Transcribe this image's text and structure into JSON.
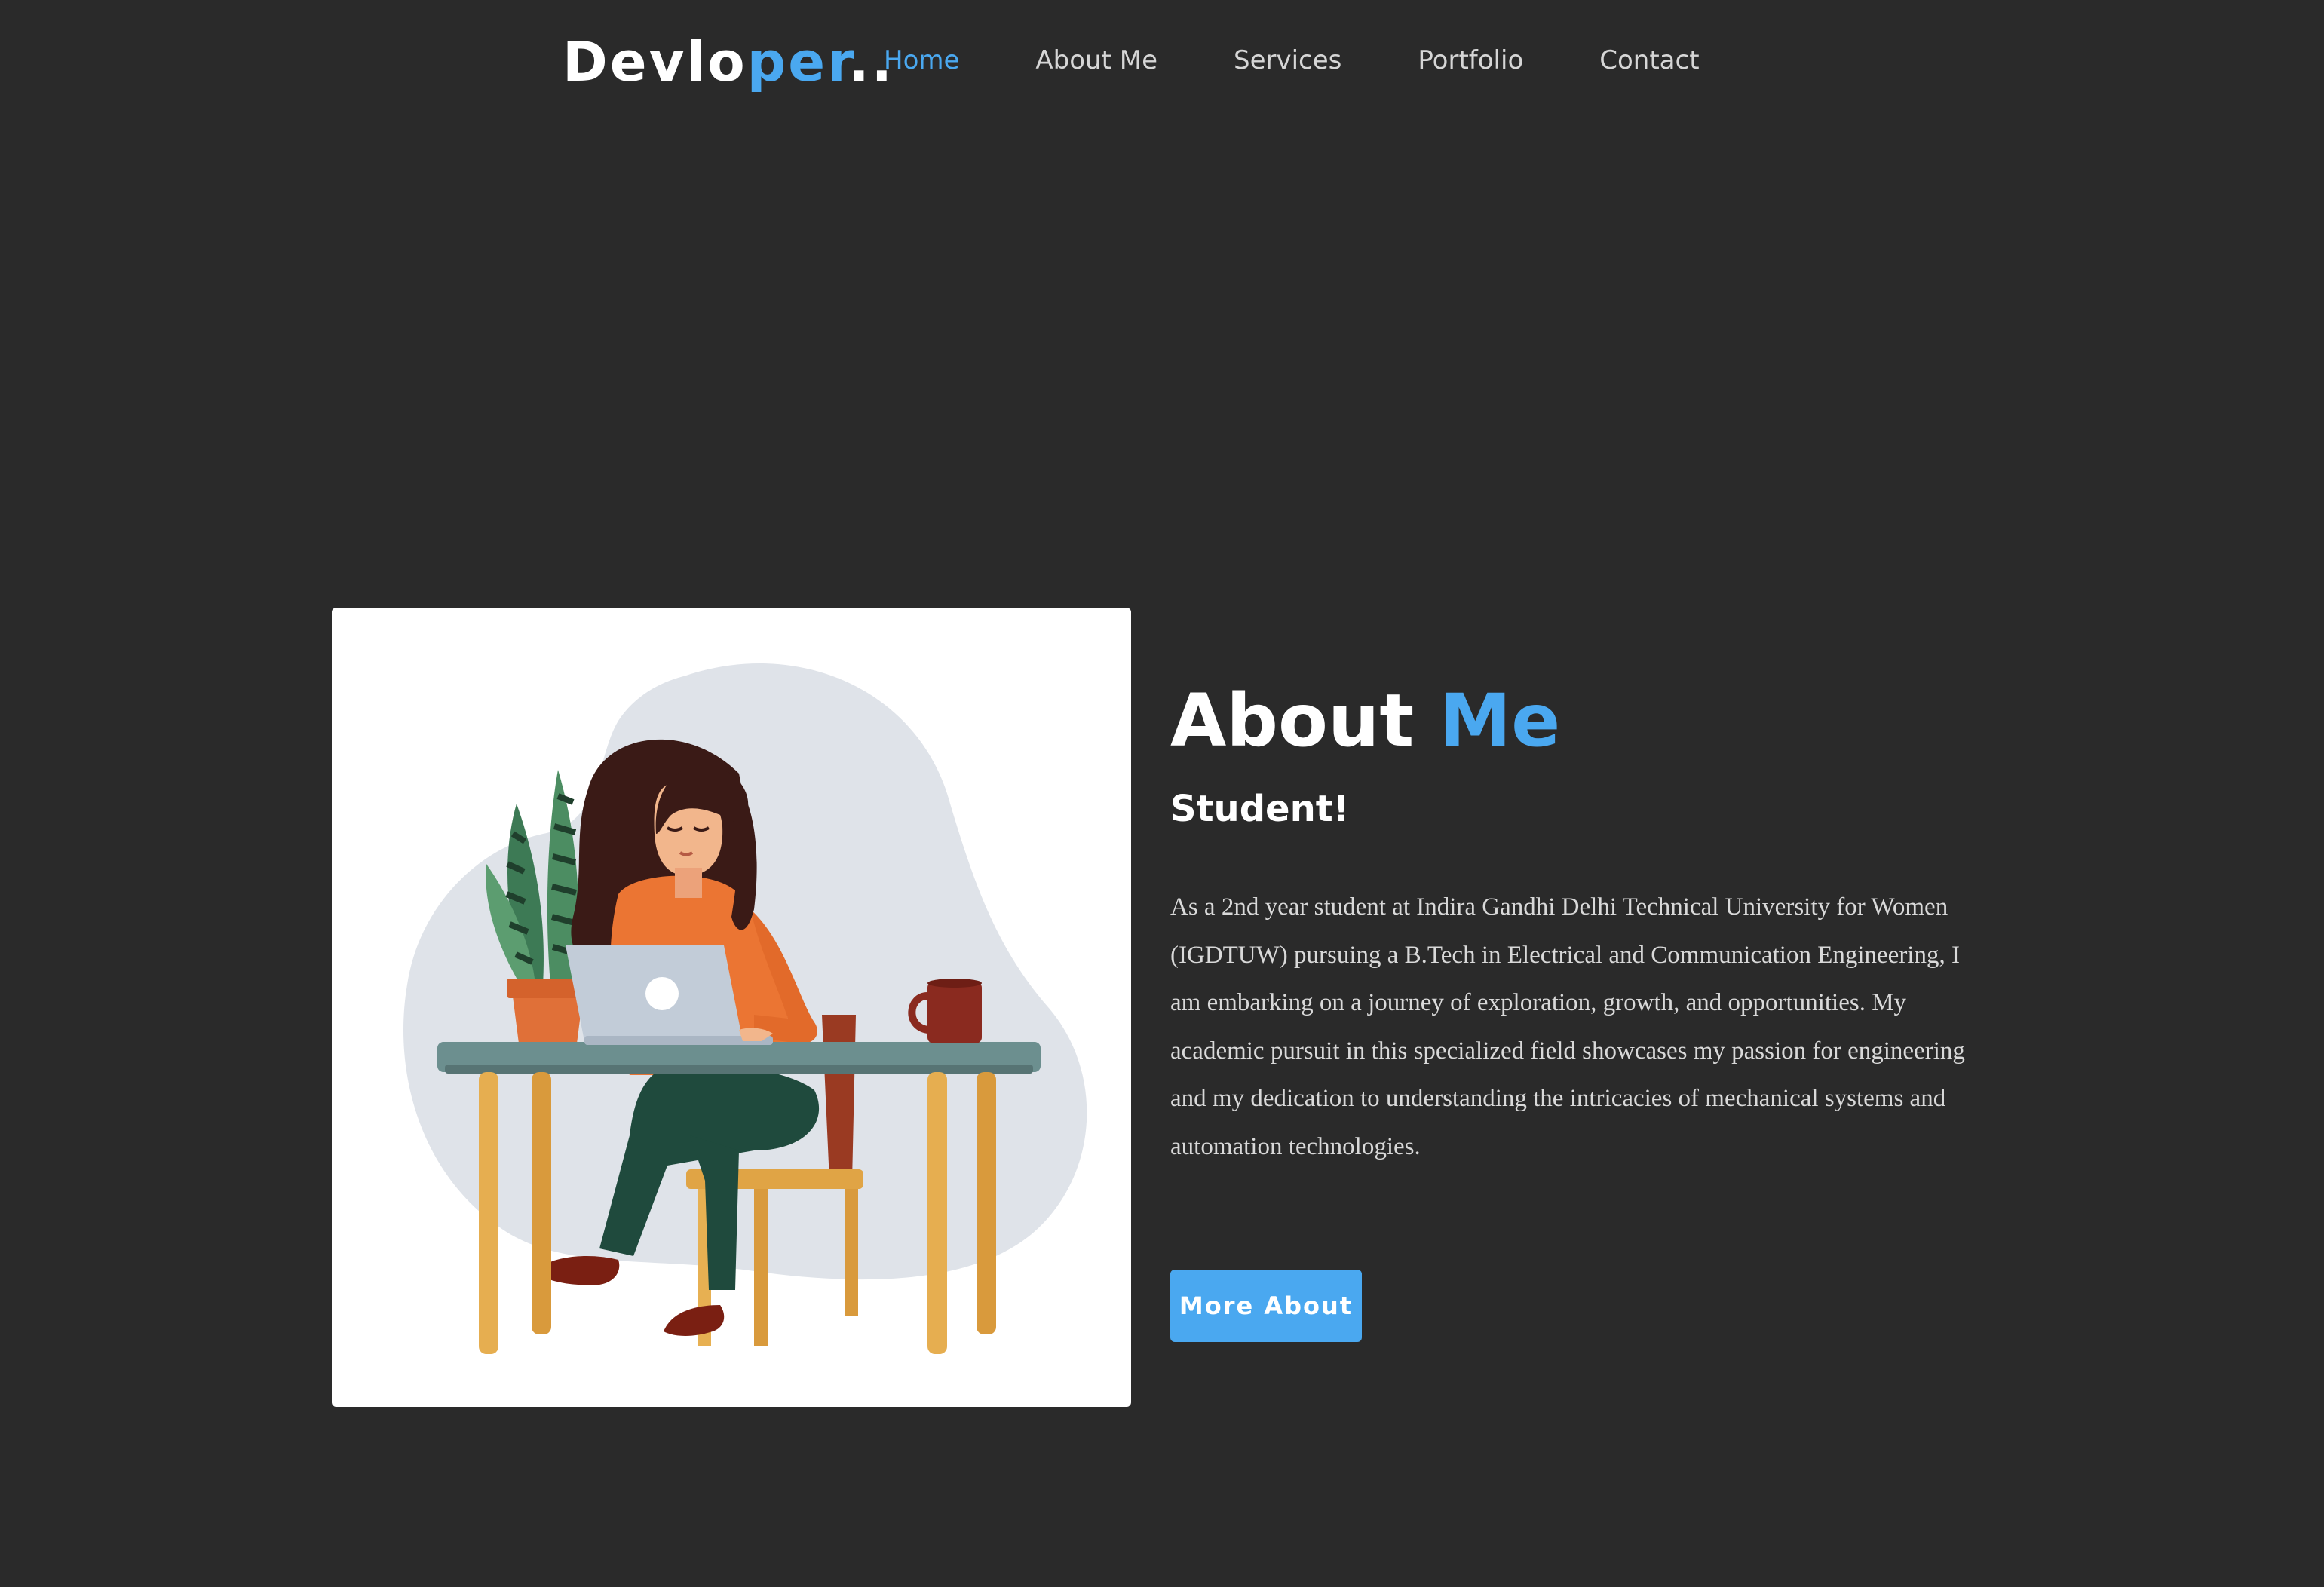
{
  "brand": {
    "logo_part1": "Devlo",
    "logo_part2": "per",
    "logo_part3": "..",
    "accent_color": "#4aa8f0"
  },
  "nav": {
    "items": [
      {
        "label": "Home",
        "active": true
      },
      {
        "label": "About Me",
        "active": false
      },
      {
        "label": "Services",
        "active": false
      },
      {
        "label": "Portfolio",
        "active": false
      },
      {
        "label": "Contact",
        "active": false
      }
    ]
  },
  "about": {
    "title_part1": "About ",
    "title_part2": "Me",
    "subtitle": "Student!",
    "bio": "As a 2nd year student at Indira Gandhi Delhi Technical University for Women (IGDTUW) pursuing a B.Tech in Electrical and Communication Engineering, I am embarking on a journey of exploration, growth, and opportunities. My academic pursuit in this specialized field showcases my passion for engineering and my dedication to understanding the intricacies of mechanical systems and automation technologies.",
    "button_label": "More About",
    "illustration": "woman-working-on-laptop-illustration"
  },
  "colors": {
    "background": "#2a2a2a",
    "accent": "#4aa8f0",
    "text": "#ffffff"
  }
}
